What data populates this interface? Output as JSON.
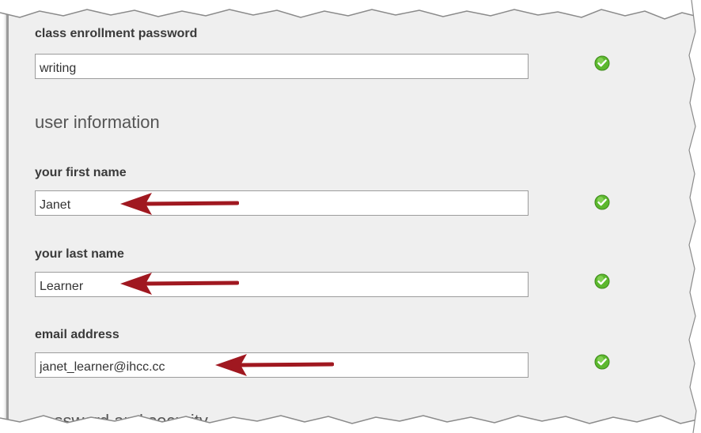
{
  "enrollment": {
    "label": "class enrollment password",
    "value": "writing"
  },
  "user_info": {
    "heading": "user information",
    "first_name": {
      "label": "your first name",
      "value": "Janet"
    },
    "last_name": {
      "label": "your last name",
      "value": "Learner"
    },
    "email": {
      "label": "email address",
      "value": "janet_learner@ihcc.cc"
    }
  },
  "password_section": {
    "heading": "password and security"
  },
  "icons": {
    "valid": "check-circle-icon",
    "pointer": "arrow-left-icon"
  },
  "colors": {
    "check_green": "#5cb82e",
    "arrow_red": "#a01820",
    "panel_bg": "#efefef"
  }
}
